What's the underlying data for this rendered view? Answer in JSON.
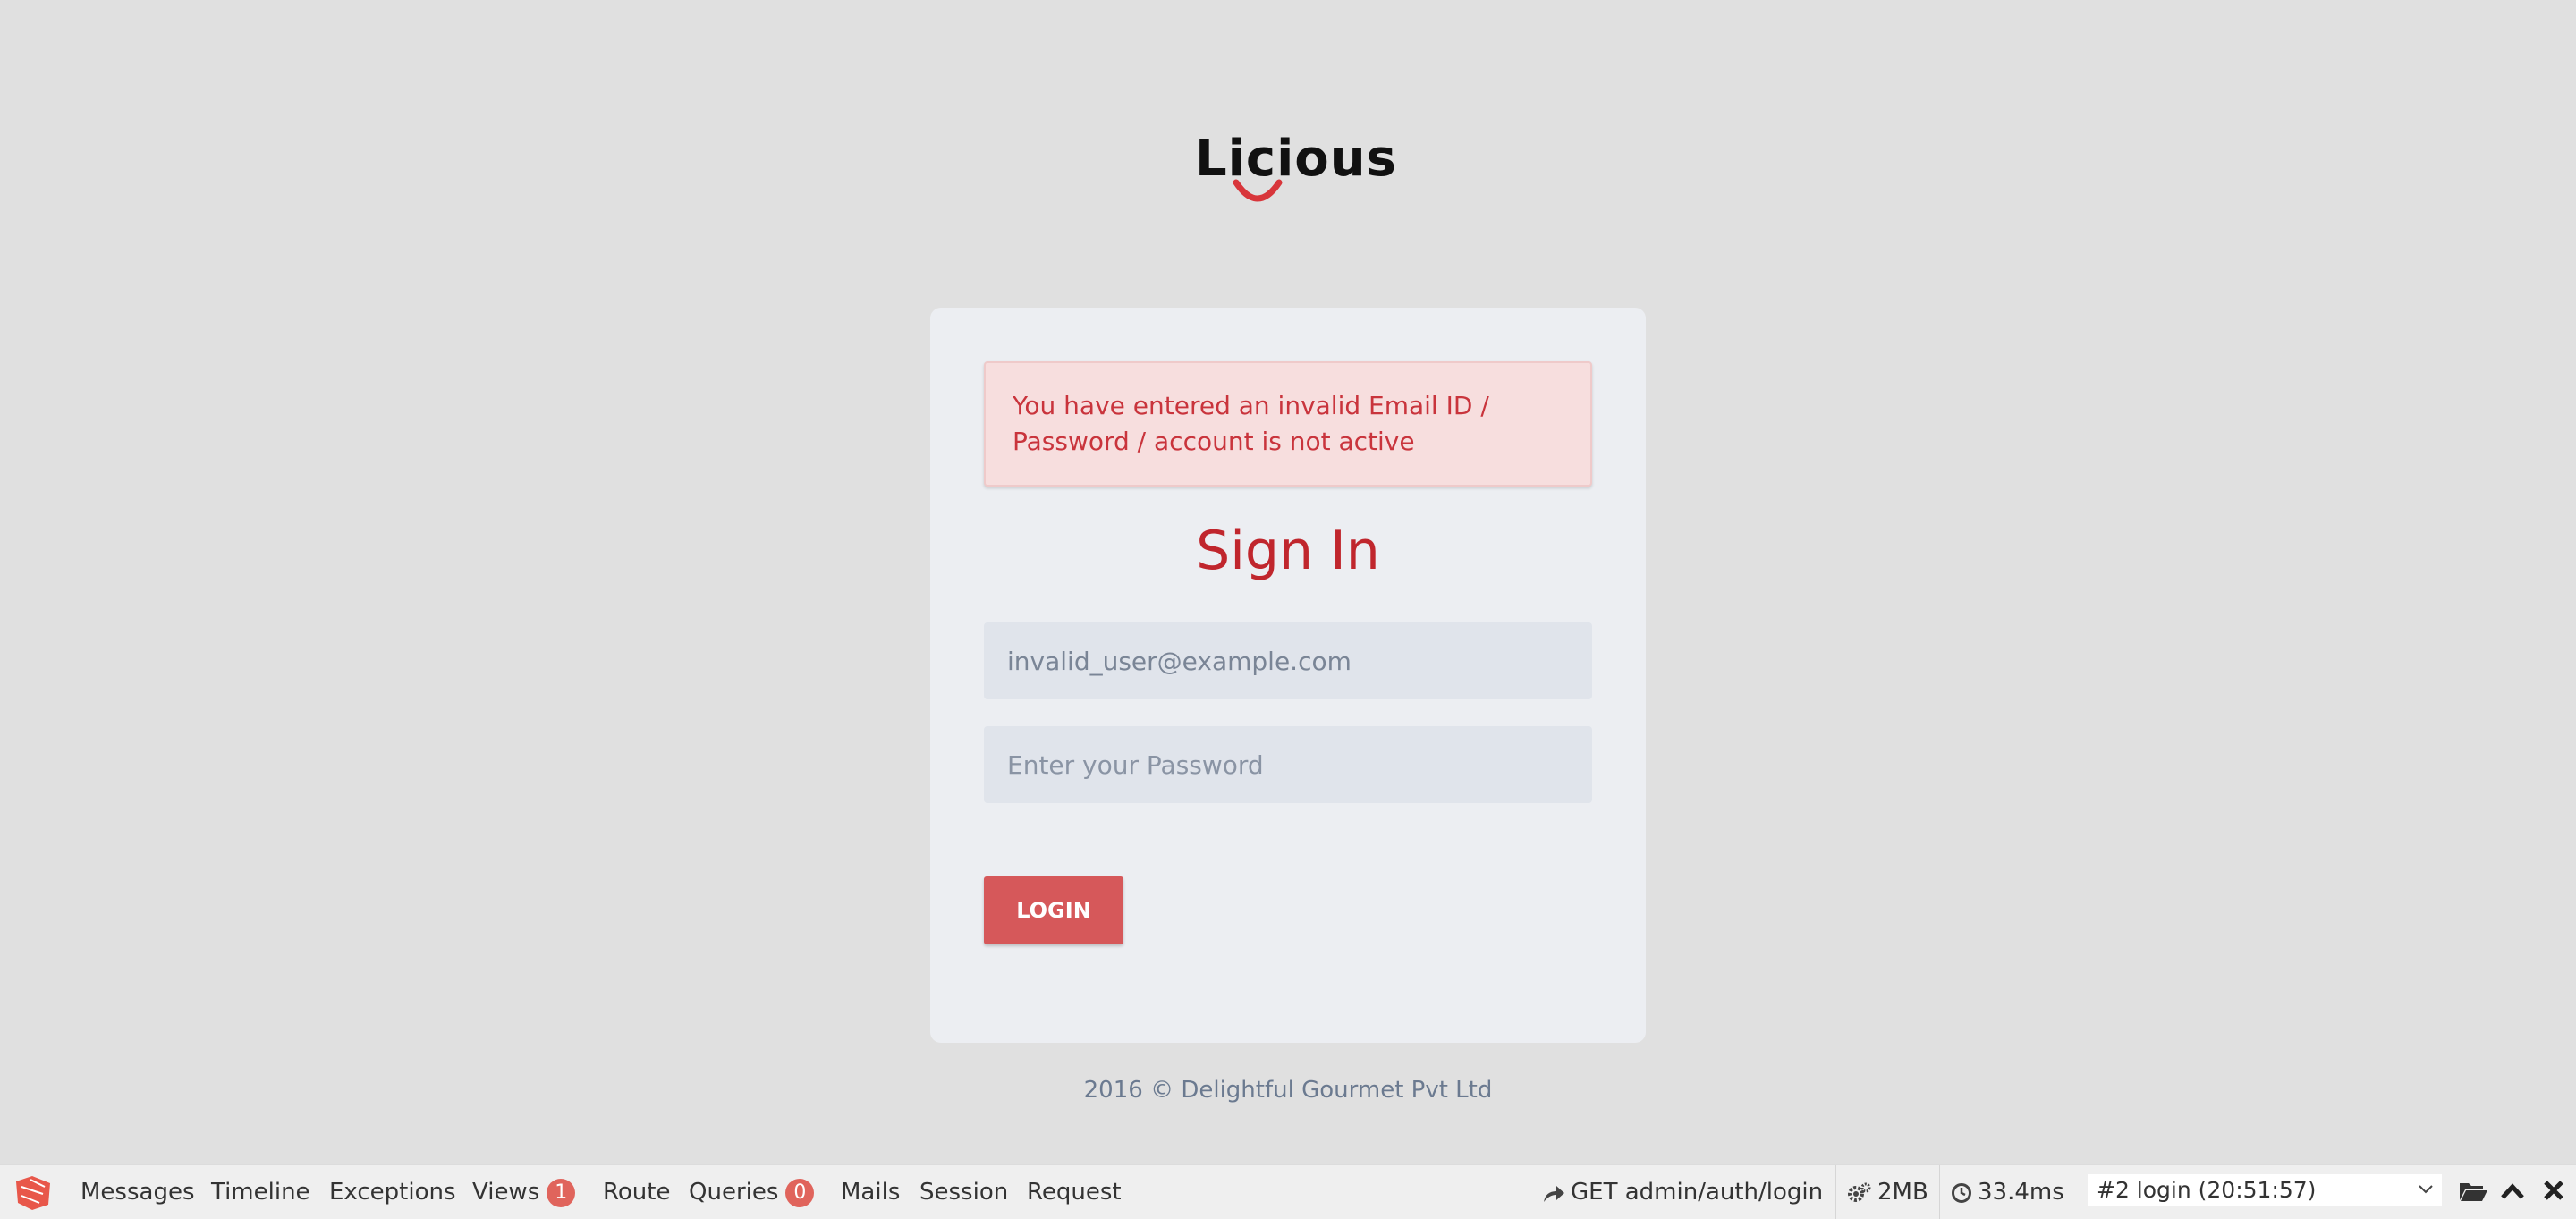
{
  "brand": {
    "logo_text": "Licious",
    "smile_color": "#d8363b"
  },
  "alert": {
    "message": "You have entered an invalid Email ID / Password / account is not active"
  },
  "form": {
    "title": "Sign In",
    "email_value": "invalid_user@example.com",
    "password_placeholder": "Enter your Password",
    "login_label": "LOGIN"
  },
  "footer": {
    "text": "2016 © Delightful Gourmet Pvt Ltd"
  },
  "debugbar": {
    "tabs": [
      {
        "label": "Messages"
      },
      {
        "label": "Timeline"
      },
      {
        "label": "Exceptions"
      },
      {
        "label": "Views",
        "badge": "1"
      },
      {
        "label": "Route"
      },
      {
        "label": "Queries",
        "badge": "0"
      },
      {
        "label": "Mails"
      },
      {
        "label": "Session"
      },
      {
        "label": "Request"
      }
    ],
    "route": "GET admin/auth/login",
    "memory": "2MB",
    "time": "33.4ms",
    "request_select": "#2 login (20:51:57)",
    "accent": "#e0645c"
  }
}
